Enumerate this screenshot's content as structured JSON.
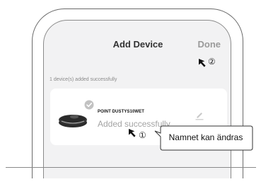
{
  "header": {
    "title": "Add Device",
    "done_label": "Done"
  },
  "status_text": "1 device(s) added successfully",
  "device": {
    "name": "POINT DUSTYS10WET",
    "status": "Added successfully",
    "icon": "robot-vacuum-icon",
    "check_badge": "checkmark-icon"
  },
  "annotations": {
    "step_1": "①",
    "step_2": "②",
    "callout_text": "Namnet kan ändras"
  },
  "colors": {
    "background": "#f2f2f3",
    "card": "#ffffff",
    "done": "#9a9a9a",
    "status_gray": "#a3a3a3"
  }
}
